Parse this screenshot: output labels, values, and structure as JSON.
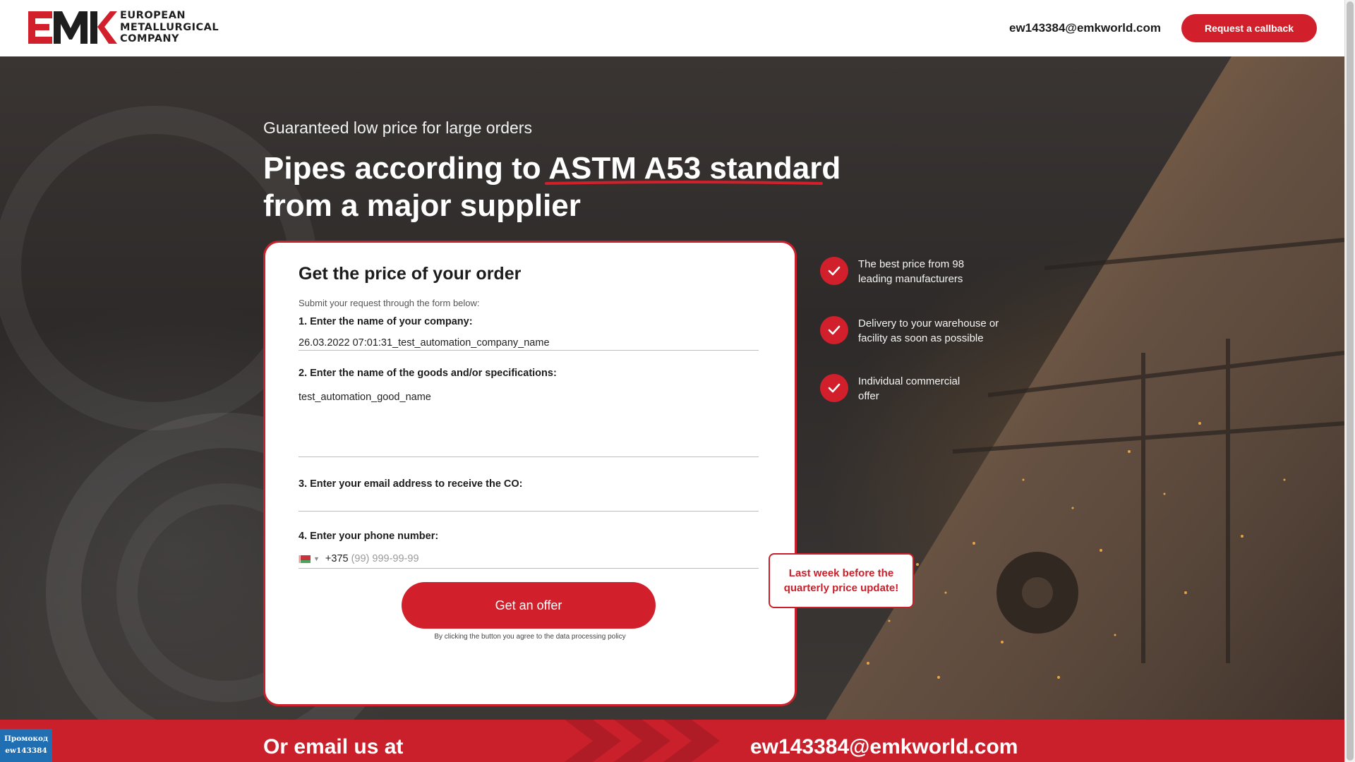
{
  "header": {
    "logo_text_lines": [
      "EUROPEAN",
      "METALLURGICAL",
      "COMPANY"
    ],
    "logo_mark": "EMK",
    "email": "ew143384@emkworld.com",
    "callback_label": "Request a callback"
  },
  "hero": {
    "subtitle": "Guaranteed low price for large orders",
    "title_line1": "Pipes according to ASTM A53 standard",
    "title_line2": "from a major supplier"
  },
  "form": {
    "title": "Get the price of your order",
    "subtitle": "Submit your request through the form below:",
    "company_label": "1. Enter the name of your company:",
    "company_value": "26.03.2022 07:01:31_test_automation_company_name",
    "goods_label": "2. Enter the name of the goods and/or specifications:",
    "goods_value": "test_automation_good_name",
    "email_label": "3. Enter your email address to receive the CO:",
    "email_value": "",
    "phone_label": "4. Enter your phone number:",
    "phone_code": "+375",
    "phone_placeholder": "(99) 999-99-99",
    "submit_label": "Get an offer",
    "agree_text": "By clicking the button you agree to the",
    "agree_link": "data processing policy"
  },
  "benefits": [
    {
      "line1": "The best price from 98",
      "line2": "leading manufacturers"
    },
    {
      "line1": "Delivery to your warehouse or",
      "line2": "facility as soon as possible"
    },
    {
      "line1": "Individual commercial",
      "line2": "offer"
    }
  ],
  "price_note": {
    "line1": "Last week before the",
    "line2": "quarterly price update!"
  },
  "band": {
    "left_text": "Or email us at",
    "email": "ew143384@emkworld.com"
  },
  "promo": {
    "line1": "Промокод",
    "line2": "ew143384"
  },
  "colors": {
    "accent": "#d1202b",
    "promo_bg": "#1f6fb2"
  },
  "icons": {
    "check": "check-icon",
    "flag": "belarus-flag-icon",
    "dropdown": "caret-down-icon"
  }
}
